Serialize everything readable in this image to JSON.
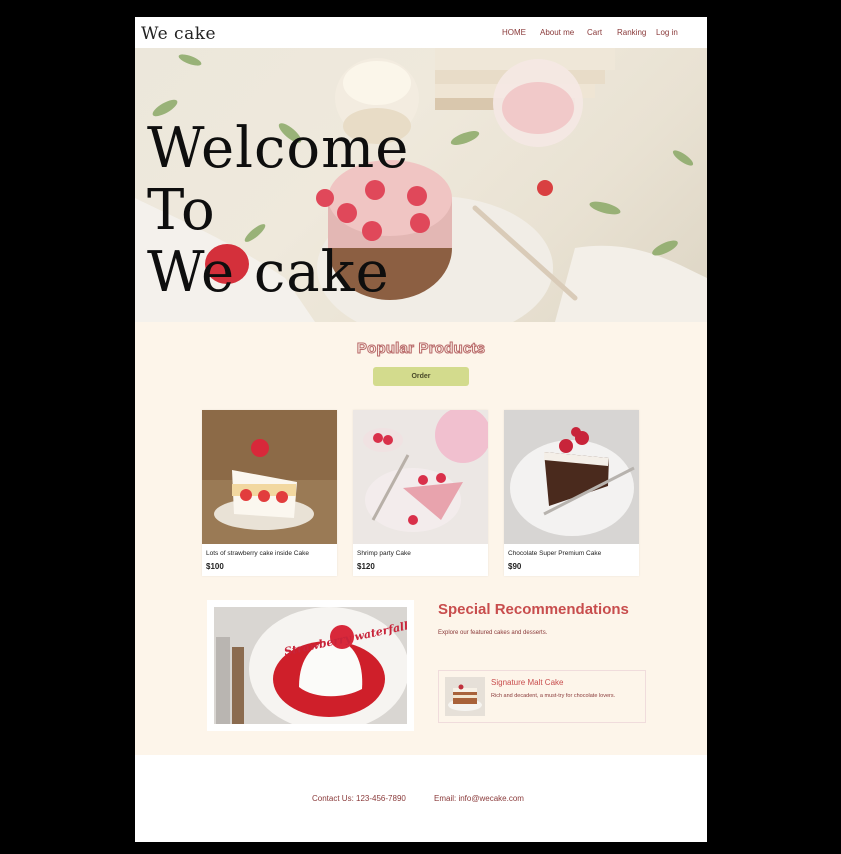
{
  "nav": {
    "logo": "We cake",
    "items": [
      "HOME",
      "About me",
      "Cart",
      "Ranking",
      "Log in"
    ]
  },
  "hero": {
    "title_lines": [
      "Welcome",
      "To",
      "We cake"
    ]
  },
  "products": {
    "title": "Popular Products",
    "order_label": "Order",
    "cards": [
      {
        "name": "Lots of strawberry cake inside Cake",
        "price": "$100"
      },
      {
        "name": "Shrimp party Cake",
        "price": "$120"
      },
      {
        "name": "Chocolate Super Premium Cake",
        "price": "$90"
      }
    ]
  },
  "special": {
    "title": "Special Recommendations",
    "subtitle": "Explore our featured cakes and desserts.",
    "image_text": "Strawberry waterfall cake",
    "item": {
      "name": "Signature Malt Cake",
      "description": "Rich and decadent, a must-try for chocolate lovers."
    }
  },
  "footer": {
    "contact": "Contact Us: 123-456-7890",
    "email": "Email: info@wecake.com"
  },
  "colors": {
    "accent": "#c84d4d",
    "order_button": "#d3db8d",
    "section_bg": "#fdf5ea",
    "link": "#8a3a3a"
  }
}
